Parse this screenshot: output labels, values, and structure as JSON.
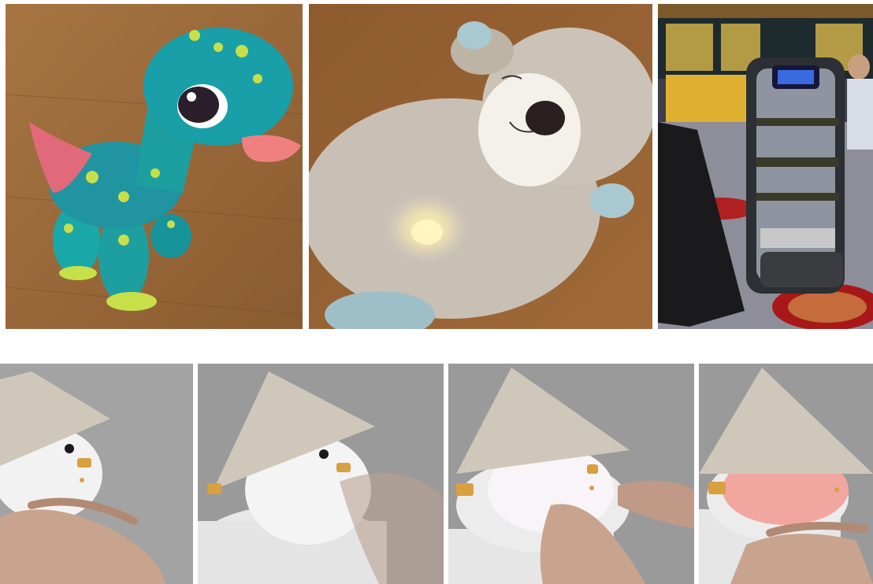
{
  "figure": {
    "top_row": [
      {
        "id": "dino",
        "subject": "plush-dinosaur-photo"
      },
      {
        "id": "otter",
        "subject": "plush-otter-photo"
      },
      {
        "id": "robot",
        "subject": "service-robot-photo"
      }
    ],
    "bottom_row": [
      {
        "id": "lamp1",
        "subject": "lamp-robot-touch-photo"
      },
      {
        "id": "lamp2",
        "subject": "lamp-robot-touch-photo"
      },
      {
        "id": "lamp3",
        "subject": "lamp-robot-touch-photo"
      },
      {
        "id": "lamp4",
        "subject": "lamp-robot-touch-photo"
      }
    ]
  },
  "colors": {
    "wood": "#9a6a3c",
    "dino_body": "#1d9fa0",
    "dino_spots": "#c7e04a",
    "dino_tongue": "#f08080",
    "otter_fur": "#c8c0b4",
    "robot_frame": "#2c2f33",
    "lamp_shade": "#cfc8ba",
    "lamp_glow_red": "#f2a6a0",
    "backdrop_gray": "#9c9c9c"
  }
}
